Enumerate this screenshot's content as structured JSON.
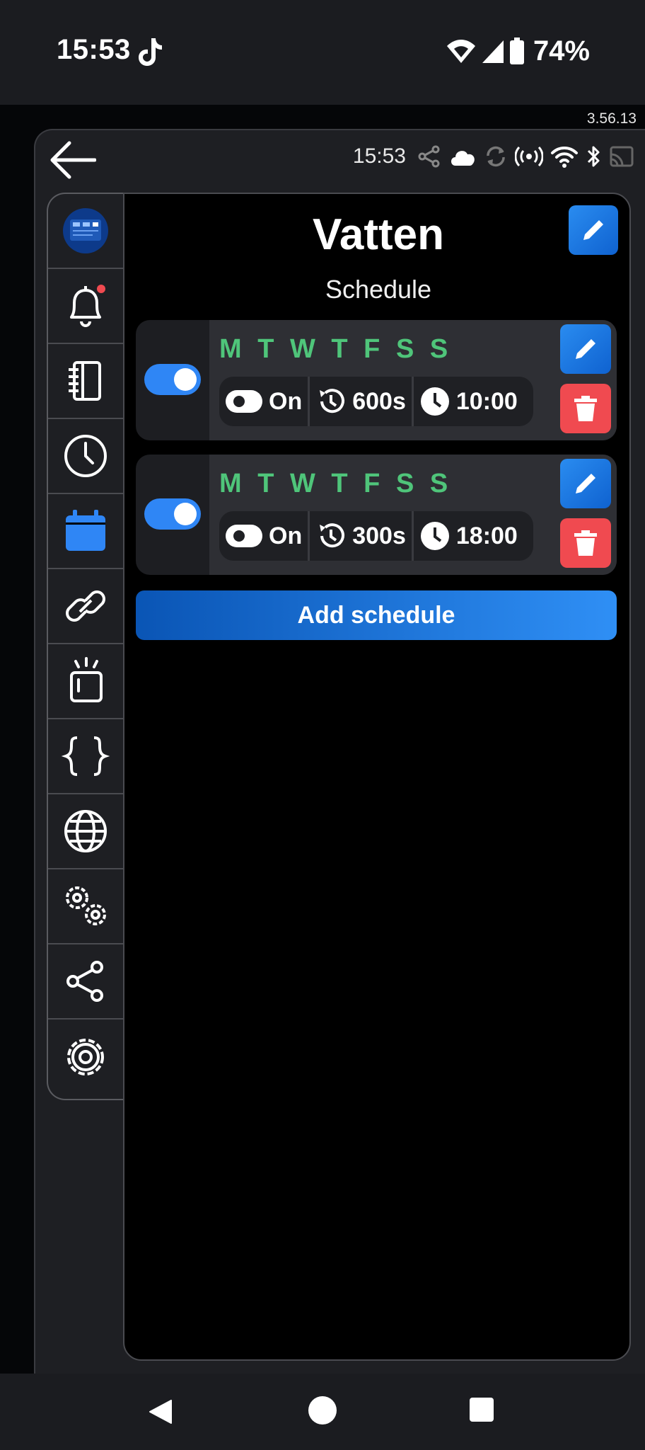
{
  "status_bar": {
    "time": "15:53",
    "battery_percent": "74%"
  },
  "app_version": "3.56.13",
  "top_bar": {
    "time": "15:53"
  },
  "sidebar": {
    "items": [
      {
        "name": "device-thumbnail",
        "active": false
      },
      {
        "name": "notifications",
        "active": false,
        "badge": true
      },
      {
        "name": "logs",
        "active": false
      },
      {
        "name": "history",
        "active": false
      },
      {
        "name": "schedule",
        "active": true
      },
      {
        "name": "links",
        "active": false
      },
      {
        "name": "actions",
        "active": false
      },
      {
        "name": "scripts",
        "active": false
      },
      {
        "name": "web",
        "active": false
      },
      {
        "name": "advanced-settings",
        "active": false
      },
      {
        "name": "share",
        "active": false
      },
      {
        "name": "settings",
        "active": false
      }
    ]
  },
  "header": {
    "title": "Vatten",
    "subtitle": "Schedule"
  },
  "schedules": [
    {
      "enabled": true,
      "days": "M T W T F S S",
      "action": "On",
      "duration": "600s",
      "time": "10:00"
    },
    {
      "enabled": true,
      "days": "M T W T F S S",
      "action": "On",
      "duration": "300s",
      "time": "18:00"
    }
  ],
  "add_button_label": "Add schedule",
  "colors": {
    "accent": "#2f86f5",
    "days_green": "#4fc57a",
    "delete_red": "#f04a50"
  }
}
